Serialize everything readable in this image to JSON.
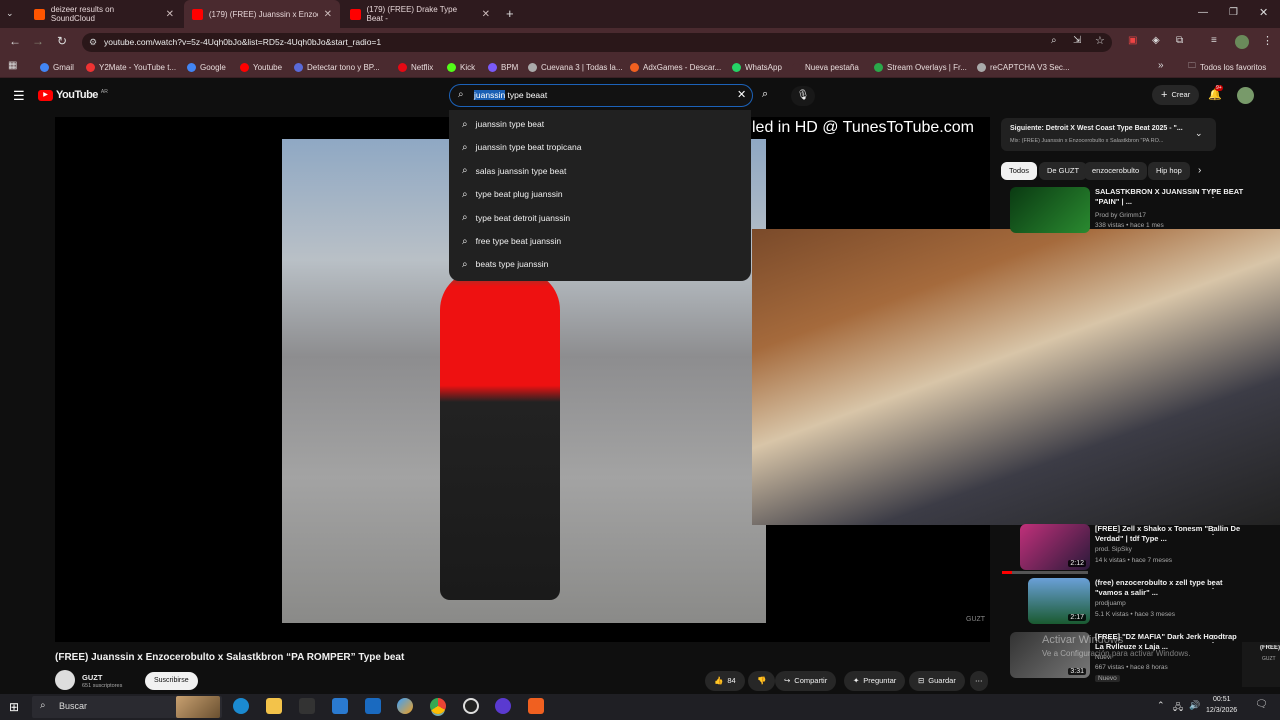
{
  "browser": {
    "tabs": [
      {
        "label": "deizeer results on SoundCloud",
        "color": "#ff5500"
      },
      {
        "label": "(179) (FREE) Juanssin x Enzocer",
        "color": "#ff0000"
      },
      {
        "label": "(179) (FREE) Drake Type Beat -",
        "color": "#ff0000"
      }
    ],
    "url": "youtube.com/watch?v=5z-4Uqh0bJo&list=RD5z-4Uqh0bJo&start_radio=1",
    "bookmarks": [
      "Gmail",
      "Y2Mate - YouTube t...",
      "Google",
      "Youtube",
      "Detectar tono y BP...",
      "Netflix",
      "Kick",
      "BPM",
      "Cuevana 3 | Todas la...",
      "AdxGames - Descar...",
      "WhatsApp",
      "Nueva pestaña",
      "Stream Overlays | Fr...",
      "reCAPTCHA V3 Sec..."
    ],
    "all_favorites": "Todos los favoritos"
  },
  "yt": {
    "logo": "YouTube",
    "region": "AR",
    "search_highlight": "juanssin",
    "search_rest": " type beaat",
    "suggestions": [
      "juanssin type beat",
      "juanssin type beat tropicana",
      "salas juanssin type beat",
      "type beat plug juanssin",
      "type beat detroit juanssin",
      "free type beat juanssin",
      "beats type juanssin"
    ],
    "create": "Crear",
    "notif_count": "9+",
    "overlay_text": "led in HD @ TunesToTube.com",
    "next_title": "Siguiente: Detroit X West Coast Type Beat 2025 - \"...",
    "next_sub": "Mix: (FREE) Juanssin x Enzocerobulto x Salastkbron \"PA RO...",
    "chips": [
      "Todos",
      "De GUZT",
      "enzocerobulto",
      "Hip hop"
    ],
    "rv1": {
      "title": "SALASTKBRON X JUANSSIN TYPE BEAT \"PAIN\" | ...",
      "ch": "Prod by Grimm17",
      "meta": "338 vistas • hace 1 mes"
    },
    "rv2": {
      "title": "[FREE] Zell x Shako x Tonesm \"Ballin De Verdad\" | tdf Type ...",
      "ch": "prod. SipSky",
      "meta": "14 k vistas • hace 7 meses",
      "dur": "2:12"
    },
    "rv3": {
      "title": "(free) enzocerobulto x zell type beat \"vamos a salir\" ...",
      "ch": "prodjuamp",
      "meta": "5.1 K vistas • hace 3 meses",
      "dur": "2:17"
    },
    "rv4": {
      "title": "[FREE] \"DZ MAFIA\" Dark Jerk Hoodtrap La Rvlleuze x Laja ...",
      "ch": "Nuevi",
      "meta": "667 vistas • hace 8 horas",
      "badge": "Nuevo",
      "dur": "3:31"
    },
    "video_title": "(FREE) Juanssin x Enzocerobulto x Salastkbron “PA ROMPER” Type beat",
    "channel": "GUZT",
    "subs": "651 suscriptores",
    "subscribe": "Suscribirse",
    "likes": "84",
    "share": "Compartir",
    "ask": "Preguntar",
    "save": "Guardar",
    "watermark": "GUZT",
    "activate1": "Activar Windows",
    "activate2": "Ve a Configuración para activar Windows.",
    "mini_label": "(FREE) Ju",
    "mini_ch": "GUZT"
  },
  "taskbar": {
    "search": "Buscar",
    "time": "00:51",
    "date": "12/3/2026"
  }
}
